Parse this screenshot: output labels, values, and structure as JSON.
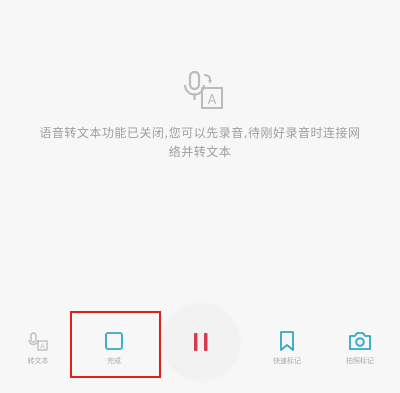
{
  "message": {
    "line1": "语音转文本功能已关闭,您可以先录音,待刚好录音时连接网",
    "line2": "络并转文本"
  },
  "toolbar": {
    "voice_to_text_label": "转文本",
    "stop_label": "完成",
    "bookmark_label": "快速标记",
    "photo_label": "拍照标记"
  },
  "colors": {
    "accent": "#2fa8c4",
    "pause": "#d83a4f",
    "highlight": "#e01e1e"
  },
  "icons": {
    "voice": "voice-to-text-icon",
    "stop": "stop-square-icon",
    "pause": "pause-icon",
    "bookmark": "bookmark-icon",
    "camera": "camera-icon"
  }
}
